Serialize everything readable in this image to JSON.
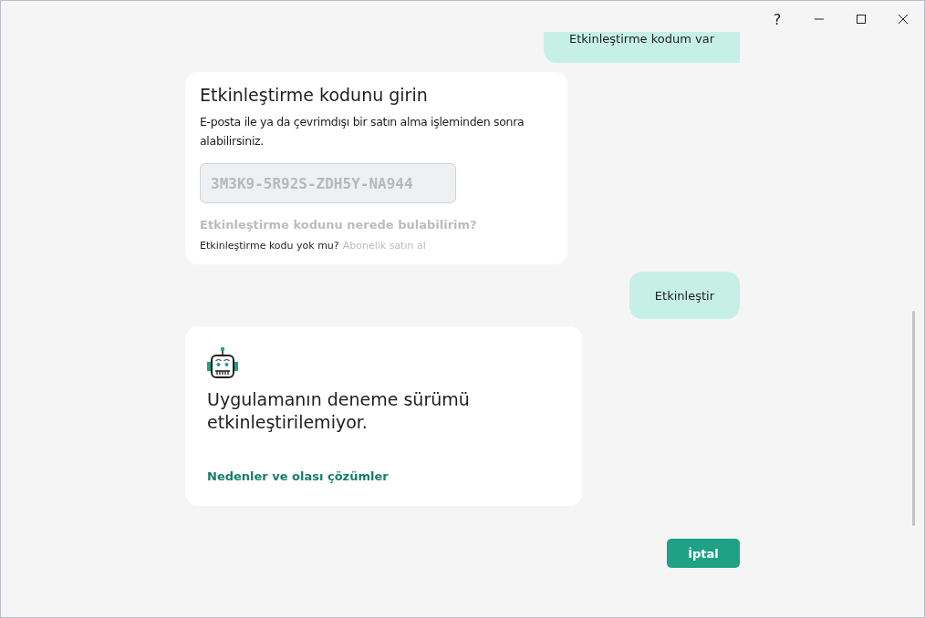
{
  "window": {
    "help_label": "?"
  },
  "messages": [
    {
      "kind": "user",
      "text": "Etkinleştirme kodum var"
    },
    {
      "kind": "code_card",
      "title": "Etkinleştirme kodunu girin",
      "description": "E-posta ile ya da çevrimdışı bir satın alma işleminden sonra alabilirsiniz.",
      "placeholder": "3M3K9-5R92S-ZDH5Y-NA944",
      "help_link": "Etkinleştirme kodunu nerede bulabilirim?",
      "question": "Etkinleştirme kodu yok mu?",
      "buy_link": "Abonelik satın al"
    },
    {
      "kind": "user",
      "text": "Etkinleştir"
    },
    {
      "kind": "error_card",
      "title": "Uygulamanın deneme sürümü etkinleştirilemiyor.",
      "link": "Nedenler ve olası çözümler"
    }
  ],
  "cancel_button": "İptal"
}
